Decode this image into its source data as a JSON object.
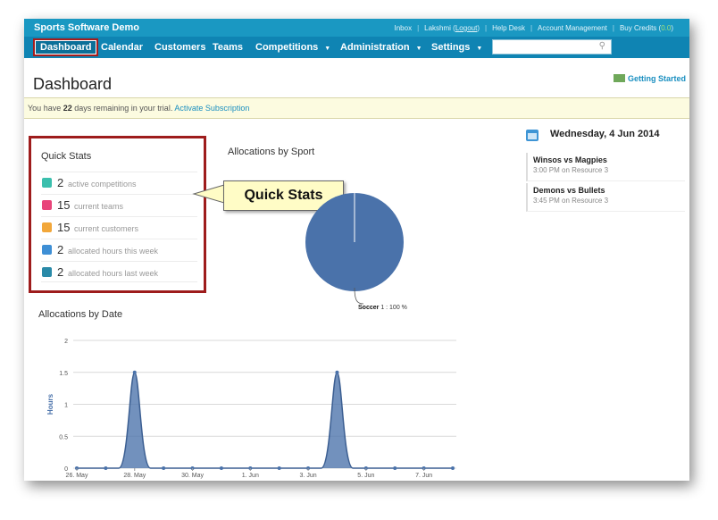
{
  "app": {
    "name": "Sports Software Demo"
  },
  "toplinks": {
    "inbox": "Inbox",
    "user": "Lakshmi",
    "logout": "Logout",
    "help": "Help Desk",
    "account": "Account Management",
    "credits_label": "Buy Credits",
    "credits_value": "0.0"
  },
  "nav": [
    {
      "label": "Dashboard"
    },
    {
      "label": "Calendar"
    },
    {
      "label": "Customers"
    },
    {
      "label": "Teams"
    },
    {
      "label": "Competitions"
    },
    {
      "label": "Administration"
    },
    {
      "label": "Settings"
    }
  ],
  "search": {
    "placeholder": ""
  },
  "page": {
    "title": "Dashboard",
    "getting_started": "Getting Started"
  },
  "trial": {
    "pre": "You have",
    "days": "22",
    "post": "days remaining in your trial.",
    "link": "Activate Subscription"
  },
  "quick_stats": {
    "title": "Quick Stats",
    "items": [
      {
        "value": "2",
        "label": "active competitions",
        "icon": "trophy-icon",
        "color": "#3bbfad"
      },
      {
        "value": "15",
        "label": "current teams",
        "icon": "team-icon",
        "color": "#e8457a"
      },
      {
        "value": "15",
        "label": "current customers",
        "icon": "user-icon",
        "color": "#f2a73a"
      },
      {
        "value": "2",
        "label": "allocated hours this week",
        "icon": "clock-icon",
        "color": "#3e8fd5"
      },
      {
        "value": "2",
        "label": "allocated hours last week",
        "icon": "clock-icon",
        "color": "#2a8aa8"
      }
    ]
  },
  "callout": {
    "text": "Quick Stats"
  },
  "calendar": {
    "date": "Wednesday, 4 Jun 2014",
    "events": [
      {
        "title": "Winsos vs Magpies",
        "sub": "3:00 PM on Resource 3"
      },
      {
        "title": "Demons vs Bullets",
        "sub": "3:45 PM on Resource 3"
      }
    ]
  },
  "chart_data": [
    {
      "type": "pie",
      "title": "Allocations by Sport",
      "slices": [
        {
          "name": "Soccer",
          "value": 1,
          "percent_label": "1 : 100 %"
        }
      ],
      "color": "#4a72aa"
    },
    {
      "type": "area",
      "title": "Allocations by Date",
      "ylabel": "Hours",
      "ylim": [
        0,
        2
      ],
      "yticks": [
        "0",
        "0.5",
        "1",
        "1.5",
        "2"
      ],
      "xticks": [
        "26. May",
        "28. May",
        "30. May",
        "1. Jun",
        "3. Jun",
        "5. Jun",
        "7. Jun"
      ],
      "x": [
        "26. May",
        "27. May",
        "28. May",
        "29. May",
        "30. May",
        "31. May",
        "1. Jun",
        "2. Jun",
        "3. Jun",
        "4. Jun",
        "5. Jun",
        "6. Jun",
        "7. Jun",
        "8. Jun"
      ],
      "values": [
        0,
        0,
        1.5,
        0,
        0,
        0,
        0,
        0,
        0,
        1.5,
        0,
        0,
        0,
        0
      ],
      "color": "#4a72aa"
    }
  ]
}
